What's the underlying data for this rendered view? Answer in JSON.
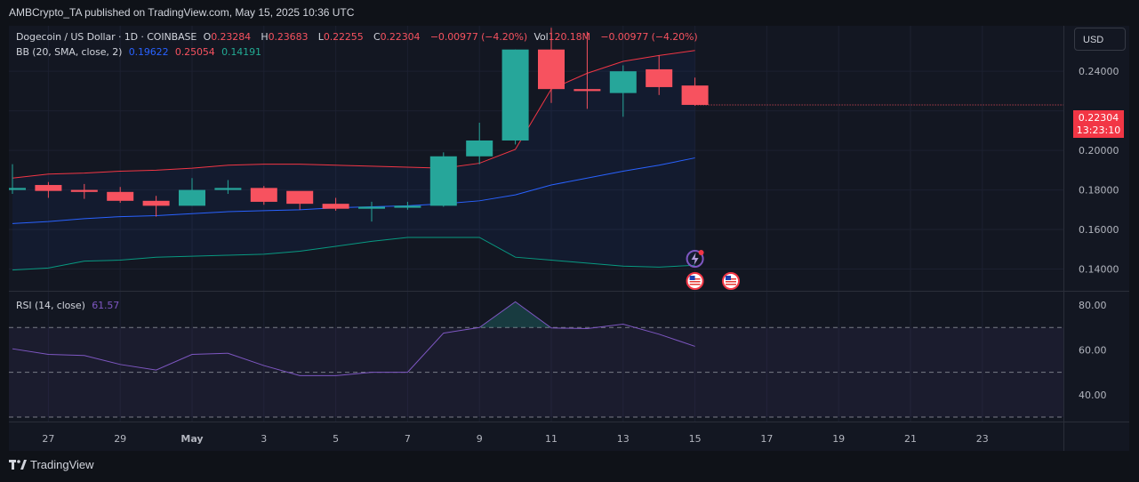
{
  "header": {
    "published": "AMBCrypto_TA published on TradingView.com, May 15, 2025 10:36 UTC"
  },
  "legend": {
    "symbol": "Dogecoin / US Dollar · 1D · COINBASE",
    "o_label": "O",
    "o_value": "0.23284",
    "h_label": "H",
    "h_value": "0.23683",
    "l_label": "L",
    "l_value": "0.22255",
    "c_label": "C",
    "c_value": "0.22304",
    "change": "−0.00977 (−4.20%)",
    "vol_label": "Vol",
    "vol_value": "120.18M",
    "vol_change": "−0.00977 (−4.20%)",
    "bb_label": "BB (20, SMA, close, 2)",
    "bb_basis": "0.19622",
    "bb_upper": "0.25054",
    "bb_lower": "0.14191",
    "rsi_label": "RSI (14, close)",
    "rsi_value": "61.57"
  },
  "currency_button": "USD",
  "last_price": {
    "value": "0.22304",
    "countdown": "13:23:10"
  },
  "footer": {
    "brand": "TradingView"
  },
  "colors": {
    "up": "#26a69a",
    "down": "#f7525f",
    "basis": "#2962ff",
    "upper_band": "#f23645",
    "lower_band": "#089981",
    "rsi": "#7e57c2"
  },
  "chart_data": [
    {
      "type": "candlestick",
      "x": [
        "Apr 26",
        "Apr 27",
        "Apr 28",
        "Apr 29",
        "Apr 30",
        "May 1",
        "May 2",
        "May 3",
        "May 4",
        "May 5",
        "May 6",
        "May 7",
        "May 8",
        "May 9",
        "May 10",
        "May 11",
        "May 12",
        "May 13",
        "May 14",
        "May 15"
      ],
      "open": [
        0.18,
        0.1825,
        0.18,
        0.179,
        0.1745,
        0.172,
        0.18,
        0.181,
        0.1795,
        0.173,
        0.1705,
        0.171,
        0.172,
        0.197,
        0.205,
        0.251,
        0.231,
        0.229,
        0.241,
        0.2328
      ],
      "high": [
        0.193,
        0.184,
        0.183,
        0.1815,
        0.177,
        0.186,
        0.185,
        0.182,
        0.179,
        0.176,
        0.174,
        0.174,
        0.199,
        0.214,
        0.251,
        0.262,
        0.26,
        0.243,
        0.248,
        0.2368
      ],
      "low": [
        0.178,
        0.176,
        0.1755,
        0.1735,
        0.1665,
        0.172,
        0.178,
        0.1725,
        0.17,
        0.1695,
        0.164,
        0.17,
        0.1715,
        0.193,
        0.203,
        0.224,
        0.221,
        0.217,
        0.228,
        0.2226
      ],
      "close": [
        0.181,
        0.1795,
        0.179,
        0.1745,
        0.172,
        0.18,
        0.181,
        0.174,
        0.173,
        0.1705,
        0.1715,
        0.172,
        0.197,
        0.205,
        0.251,
        0.231,
        0.23,
        0.24,
        0.232,
        0.223
      ],
      "bb_upper": [
        0.186,
        0.188,
        0.1885,
        0.1895,
        0.19,
        0.191,
        0.1925,
        0.193,
        0.193,
        0.1925,
        0.192,
        0.1915,
        0.191,
        0.1935,
        0.2005,
        0.231,
        0.239,
        0.245,
        0.248,
        0.2505
      ],
      "bb_basis": [
        0.163,
        0.164,
        0.1655,
        0.1665,
        0.167,
        0.168,
        0.169,
        0.1695,
        0.17,
        0.171,
        0.1715,
        0.172,
        0.173,
        0.1745,
        0.1775,
        0.1825,
        0.186,
        0.1895,
        0.1925,
        0.1962
      ],
      "bb_lower": [
        0.1395,
        0.1405,
        0.144,
        0.1445,
        0.146,
        0.1465,
        0.147,
        0.1475,
        0.149,
        0.1515,
        0.154,
        0.156,
        0.156,
        0.156,
        0.146,
        0.1445,
        0.143,
        0.1415,
        0.141,
        0.1419
      ],
      "y_ticks": [
        "0.14000",
        "0.16000",
        "0.18000",
        "0.20000",
        "0.24000"
      ],
      "ylim": [
        0.129,
        0.263
      ]
    },
    {
      "type": "line",
      "name": "RSI (14, close)",
      "values": [
        60.5,
        58.0,
        57.5,
        53.5,
        51.0,
        58.0,
        58.5,
        53.0,
        48.5,
        48.5,
        50.0,
        50.0,
        67.5,
        70.0,
        81.5,
        69.8,
        69.5,
        71.5,
        67.0,
        61.6
      ],
      "y_ticks": [
        "40.00",
        "60.00",
        "80.00"
      ],
      "bands": {
        "upper": 70,
        "middle": 50,
        "lower": 30
      },
      "ylim": [
        28.0,
        86.0
      ]
    }
  ],
  "x_axis_ticks": [
    "27",
    "29",
    "May",
    "3",
    "5",
    "7",
    "9",
    "11",
    "13",
    "15",
    "17",
    "19",
    "21",
    "23"
  ]
}
